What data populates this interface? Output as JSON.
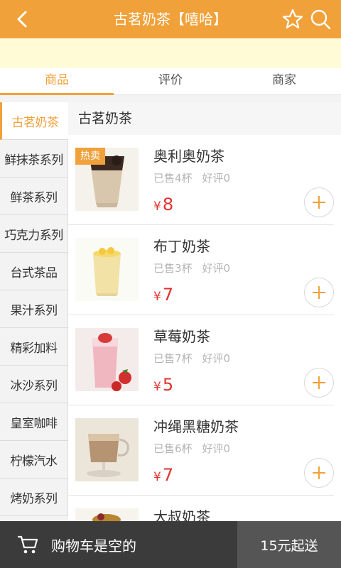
{
  "header": {
    "title": "古茗奶茶【嘻哈】",
    "back_icon": "chevron-left-icon",
    "favorite_icon": "star-outline-icon",
    "search_icon": "search-icon",
    "accent_color": "#f0a13a"
  },
  "tabs": [
    {
      "label": "商品",
      "active": true
    },
    {
      "label": "评价",
      "active": false
    },
    {
      "label": "商家",
      "active": false
    }
  ],
  "sidebar": {
    "items": [
      {
        "label": "古茗奶茶",
        "active": true
      },
      {
        "label": "鲜抹茶系列"
      },
      {
        "label": "鲜茶系列"
      },
      {
        "label": "巧克力系列"
      },
      {
        "label": "台式茶品"
      },
      {
        "label": "果汁系列"
      },
      {
        "label": "精彩加料"
      },
      {
        "label": "冰沙系列"
      },
      {
        "label": "皇室咖啡"
      },
      {
        "label": "柠檬汽水"
      },
      {
        "label": "烤奶系列"
      }
    ]
  },
  "content": {
    "category_title": "古茗奶茶",
    "products": [
      {
        "name": "奥利奥奶茶",
        "sold": "已售4杯",
        "rating": "好评0",
        "currency": "¥",
        "price": "8",
        "badge": "热卖"
      },
      {
        "name": "布丁奶茶",
        "sold": "已售3杯",
        "rating": "好评0",
        "currency": "¥",
        "price": "7"
      },
      {
        "name": "草莓奶茶",
        "sold": "已售7杯",
        "rating": "好评0",
        "currency": "¥",
        "price": "5"
      },
      {
        "name": "冲绳黑糖奶茶",
        "sold": "已售6杯",
        "rating": "好评0",
        "currency": "¥",
        "price": "7"
      },
      {
        "name": "大叔奶茶"
      }
    ],
    "price_color": "#e0332f"
  },
  "cart": {
    "icon": "cart-icon",
    "empty_text": "购物车是空的",
    "min_order": "15元起送"
  }
}
